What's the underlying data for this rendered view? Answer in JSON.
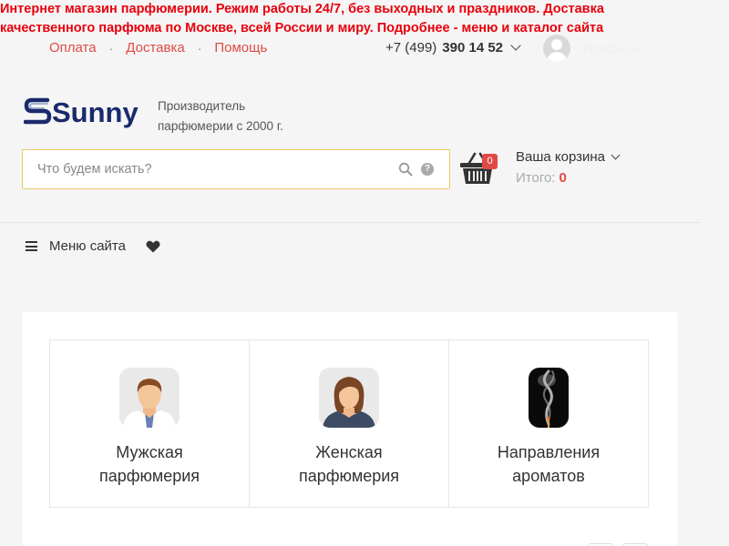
{
  "announcement": "Интернет магазин парфюмерии. Режим работы 24/7, без выходных и праздников. Доставка качественного парфюма по Москве, всей России и миру. Подробнее - меню и каталог сайта",
  "topnav": {
    "items": [
      "Оплата",
      "Доставка",
      "Помощь"
    ],
    "separator": "·"
  },
  "phone": {
    "prefix": "+7 (499)",
    "number": "390 14 52"
  },
  "user": {
    "label": "Профиль"
  },
  "brand": {
    "logo_text": "Sunny",
    "tagline_line1": "Производитель",
    "tagline_line2": "парфюмерии с 2000 г."
  },
  "search": {
    "placeholder": "Что будем искать?",
    "value": "",
    "help": "?"
  },
  "cart": {
    "title": "Ваша корзина",
    "count": "0",
    "total_label": "Итого:",
    "total_value": "0"
  },
  "menu": {
    "label": "Меню сайта"
  },
  "categories": [
    {
      "line1": "Мужская",
      "line2": "парфюмерия",
      "icon": "man-avatar-icon"
    },
    {
      "line1": "Женская",
      "line2": "парфюмерия",
      "icon": "woman-avatar-icon"
    },
    {
      "line1": "Направления",
      "line2": "ароматов",
      "icon": "smoke-icon"
    }
  ],
  "colors": {
    "announcement": "#e8000b",
    "accent": "#e04a44",
    "search_border": "#e8c968",
    "logo_blue": "#1a2a6c"
  }
}
